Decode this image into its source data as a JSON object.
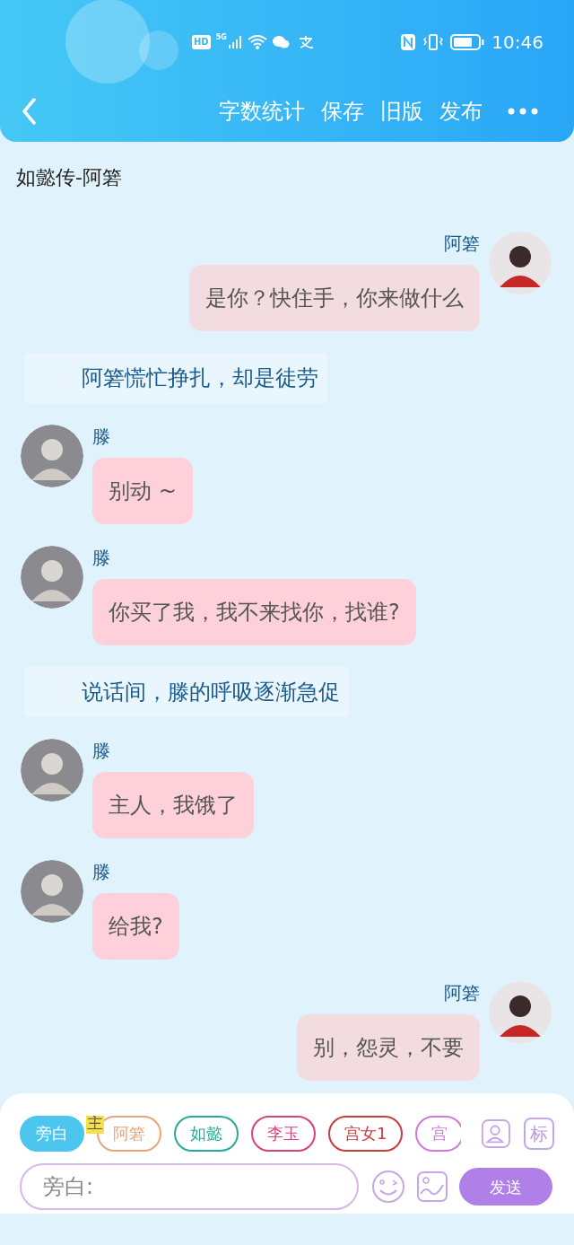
{
  "status_bar": {
    "left_icons": [
      "HD",
      "5G"
    ],
    "time": "10:46"
  },
  "nav": {
    "actions": [
      "字数统计",
      "保存",
      "旧版",
      "发布"
    ]
  },
  "title": "如懿传-阿箬",
  "messages": [
    {
      "kind": "right",
      "name": "阿箬",
      "text": "是你？快住手，你来做什么"
    },
    {
      "kind": "narration",
      "text": "阿箬慌忙挣扎，却是徒劳"
    },
    {
      "kind": "left",
      "name": "滕",
      "text": "别动 ~"
    },
    {
      "kind": "left",
      "name": "滕",
      "text": "你买了我，我不来找你，找谁?"
    },
    {
      "kind": "narration",
      "text": "说话间，滕的呼吸逐渐急促"
    },
    {
      "kind": "left",
      "name": "滕",
      "text": "主人，我饿了"
    },
    {
      "kind": "left",
      "name": "滕",
      "text": "给我?"
    },
    {
      "kind": "right",
      "name": "阿箬",
      "text": "别，怨灵，不要"
    }
  ],
  "roles": [
    {
      "label": "旁白",
      "selected": true,
      "color": "#4cc6ee"
    },
    {
      "label": "阿箬",
      "selected": false,
      "color": "#e8a57a",
      "badge": "主"
    },
    {
      "label": "如懿",
      "selected": false,
      "color": "#2aa996"
    },
    {
      "label": "李玉",
      "selected": false,
      "color": "#d8407f"
    },
    {
      "label": "宫女1",
      "selected": false,
      "color": "#c83c3c"
    },
    {
      "label": "宫",
      "selected": false,
      "color": "#d07ad8"
    }
  ],
  "mark_button": "标",
  "input": {
    "placeholder": "旁白:"
  },
  "send_button": "发送"
}
